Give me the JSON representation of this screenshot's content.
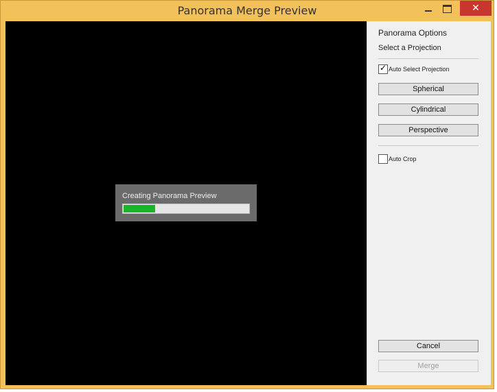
{
  "window": {
    "title": "Panorama Merge Preview",
    "close_glyph": "✕",
    "accent": "#f3c15a",
    "close_color": "#c7372f"
  },
  "progress": {
    "label": "Creating Panorama Preview",
    "fraction": 0.25,
    "fill_color": "#1ab62a"
  },
  "options": {
    "heading": "Panorama Options",
    "projection_label": "Select a Projection",
    "auto_select": {
      "label": "Auto Select Projection",
      "checked": true,
      "mark": "✓"
    },
    "buttons": [
      "Spherical",
      "Cylindrical",
      "Perspective"
    ],
    "auto_crop": {
      "label": "Auto Crop",
      "checked": false
    }
  },
  "actions": {
    "cancel": "Cancel",
    "merge": "Merge",
    "merge_enabled": false
  }
}
